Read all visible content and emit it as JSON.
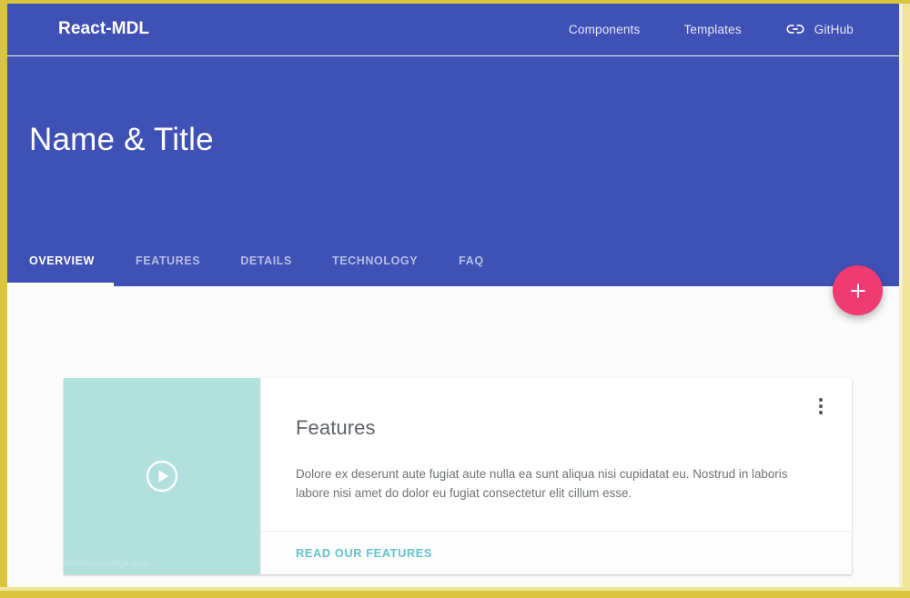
{
  "navbar": {
    "brand": "React-MDL",
    "links": [
      {
        "label": "Components",
        "icon": null
      },
      {
        "label": "Templates",
        "icon": null
      },
      {
        "label": "GitHub",
        "icon": "link-icon"
      }
    ]
  },
  "hero": {
    "title": "Name & Title"
  },
  "tabs": [
    {
      "label": "OVERVIEW",
      "active": true
    },
    {
      "label": "FEATURES",
      "active": false
    },
    {
      "label": "DETAILS",
      "active": false
    },
    {
      "label": "TECHNOLOGY",
      "active": false
    },
    {
      "label": "FAQ",
      "active": false
    }
  ],
  "fab": {
    "icon": "plus-icon",
    "label": "+"
  },
  "card": {
    "media": {
      "icon": "play-circle-icon",
      "watermark": "eritagechristiancollege.com"
    },
    "title": "Features",
    "text": "Dolore ex deserunt aute fugiat aute nulla ea sunt aliqua nisi cupidatat eu. Nostrud in laboris labore nisi amet do dolor eu fugiat consectetur elit cillum esse.",
    "menu_icon": "more-vert-icon",
    "action_label": "READ OUR FEATURES"
  },
  "colors": {
    "primary": "#3f51b5",
    "accent": "#ef3a72",
    "media": "#b2e1dd",
    "link": "#63c4c9",
    "frame": "#d9c63d",
    "background": "#fcfbfb"
  }
}
